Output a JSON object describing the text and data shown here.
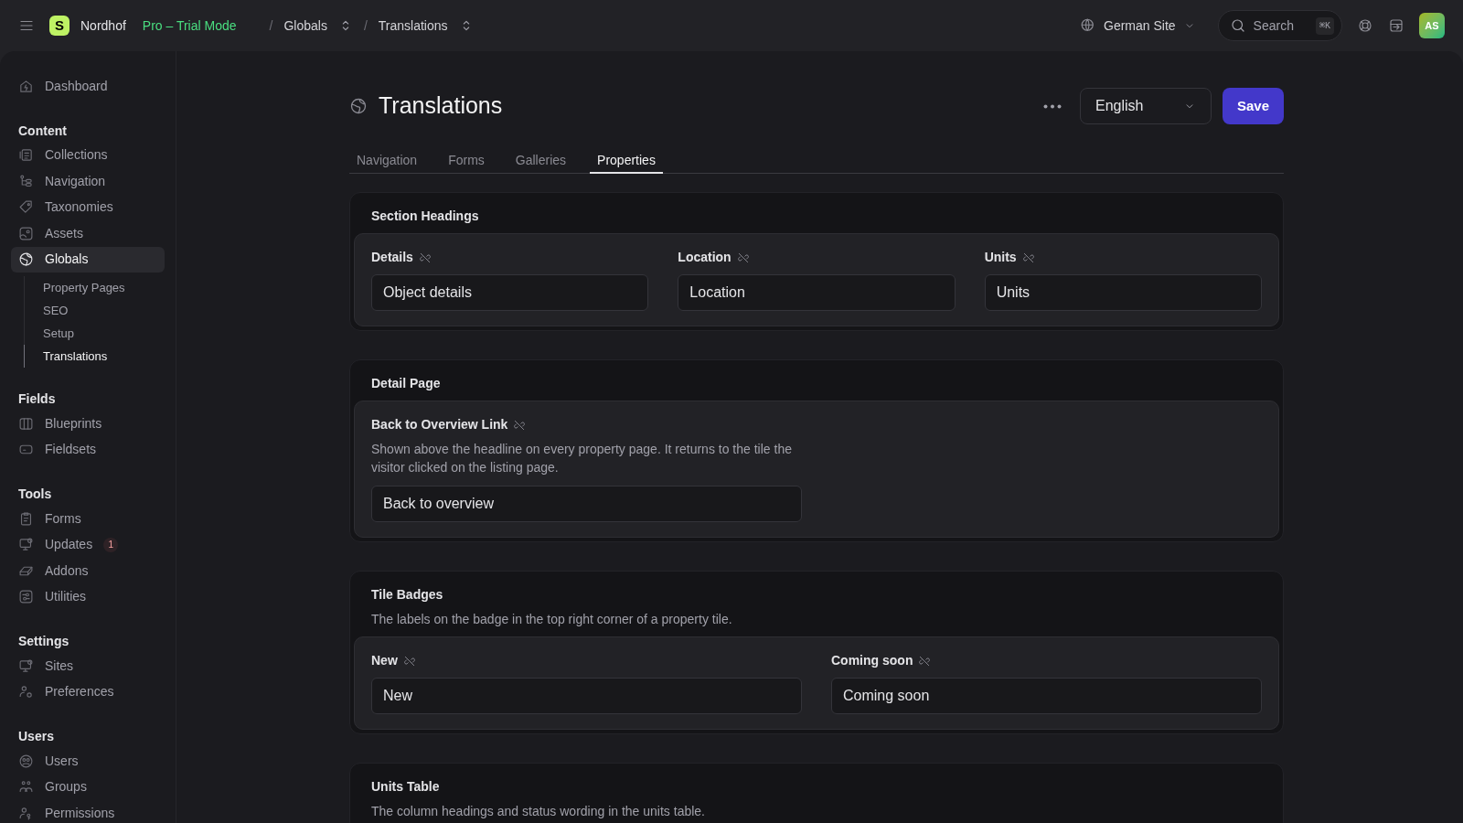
{
  "topbar": {
    "brand": "Nordhof",
    "logo_letter": "S",
    "plan": "Pro – Trial Mode",
    "separator": "/",
    "breadcrumbs": [
      {
        "label": "Globals"
      },
      {
        "label": "Translations"
      }
    ],
    "site": "German Site",
    "search": {
      "placeholder": "Search",
      "shortcut": "⌘K"
    },
    "avatar": "AS"
  },
  "sidebar": {
    "top_items": [
      {
        "label": "Dashboard",
        "selected": false
      }
    ],
    "sections": [
      {
        "title": "Content",
        "items": [
          {
            "label": "Collections",
            "selected": false
          },
          {
            "label": "Navigation",
            "selected": false
          },
          {
            "label": "Taxonomies",
            "selected": false
          },
          {
            "label": "Assets",
            "selected": false
          },
          {
            "label": "Globals",
            "selected": true,
            "children": [
              {
                "label": "Property Pages",
                "selected": false
              },
              {
                "label": "SEO",
                "selected": false
              },
              {
                "label": "Setup",
                "selected": false
              },
              {
                "label": "Translations",
                "selected": true
              }
            ]
          }
        ]
      },
      {
        "title": "Fields",
        "items": [
          {
            "label": "Blueprints",
            "selected": false
          },
          {
            "label": "Fieldsets",
            "selected": false
          }
        ]
      },
      {
        "title": "Tools",
        "items": [
          {
            "label": "Forms",
            "selected": false
          },
          {
            "label": "Updates",
            "selected": false,
            "badge": "1"
          },
          {
            "label": "Addons",
            "selected": false
          },
          {
            "label": "Utilities",
            "selected": false
          }
        ]
      },
      {
        "title": "Settings",
        "items": [
          {
            "label": "Sites",
            "selected": false
          },
          {
            "label": "Preferences",
            "selected": false
          }
        ]
      },
      {
        "title": "Users",
        "items": [
          {
            "label": "Users",
            "selected": false
          },
          {
            "label": "Groups",
            "selected": false
          },
          {
            "label": "Permissions",
            "selected": false
          }
        ]
      }
    ]
  },
  "page": {
    "title": "Translations",
    "language": "English",
    "save": "Save",
    "tabs": [
      {
        "label": "Navigation",
        "selected": false
      },
      {
        "label": "Forms",
        "selected": false
      },
      {
        "label": "Galleries",
        "selected": false
      },
      {
        "label": "Properties",
        "selected": true
      }
    ],
    "sections": [
      {
        "title": "Section Headings",
        "fields": [
          {
            "label": "Details",
            "value": "Object details"
          },
          {
            "label": "Location",
            "value": "Location"
          },
          {
            "label": "Units",
            "value": "Units"
          }
        ]
      },
      {
        "title": "Detail Page",
        "fields": [
          {
            "label": "Back to Overview Link",
            "description": "Shown above the headline on every property page. It returns to the tile the visitor clicked on the listing page.",
            "value": "Back to overview"
          }
        ]
      },
      {
        "title": "Tile Badges",
        "description": "The labels on the badge in the top right corner of a property tile.",
        "fields": [
          {
            "label": "New",
            "value": "New"
          },
          {
            "label": "Coming soon",
            "value": "Coming soon"
          }
        ]
      },
      {
        "title": "Units Table",
        "description": "The column headings and status wording in the units table."
      }
    ]
  }
}
